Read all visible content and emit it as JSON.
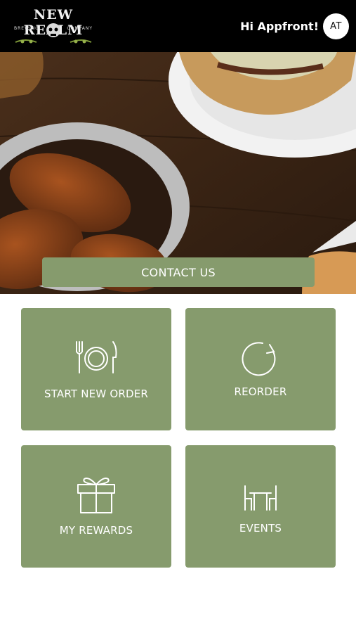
{
  "header": {
    "brand_name": "NEW REALM",
    "brand_sub_left": "BREWING",
    "brand_sub_right": "COMPANY",
    "greeting": "Hi Appfront!",
    "avatar_initials": "AT"
  },
  "hero": {
    "contact_label": "CONTACT US"
  },
  "tiles": [
    {
      "label": "START NEW ORDER",
      "icon": "utensils-plate-icon"
    },
    {
      "label": "REORDER",
      "icon": "refresh-icon"
    },
    {
      "label": "MY REWARDS",
      "icon": "gift-icon"
    },
    {
      "label": "EVENTS",
      "icon": "table-chairs-icon"
    }
  ],
  "colors": {
    "header_bg": "#000000",
    "tile_bg": "#869b6d",
    "text_light": "#ffffff"
  }
}
